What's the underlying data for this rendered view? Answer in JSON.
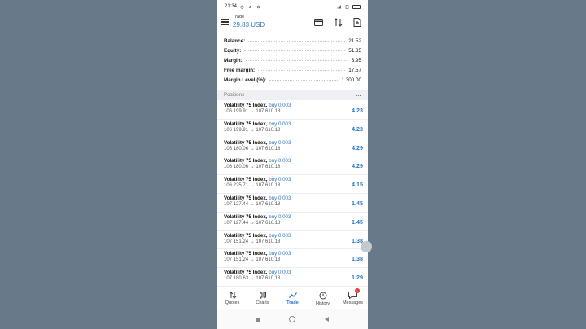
{
  "status": {
    "time": "21:34"
  },
  "header": {
    "title": "Trade",
    "balance": "29.83 USD"
  },
  "balances": [
    {
      "label": "Balance:",
      "value": "21.52"
    },
    {
      "label": "Equity:",
      "value": "51.35"
    },
    {
      "label": "Margin:",
      "value": "3.95"
    },
    {
      "label": "Free margin:",
      "value": "17.57"
    },
    {
      "label": "Margin Level (%):",
      "value": "1 300.00"
    }
  ],
  "positions_header": {
    "title": "Positions",
    "more": "..."
  },
  "positions": [
    {
      "symbol": "Volatility 75 Index,",
      "side": "buy 0.003",
      "prices": "106 199.91 → 107 610.18",
      "profit": "4.23"
    },
    {
      "symbol": "Volatility 75 Index,",
      "side": "buy 0.003",
      "prices": "106 199.91 → 107 610.18",
      "profit": "4.23"
    },
    {
      "symbol": "Volatility 75 Index,",
      "side": "buy 0.003",
      "prices": "106 180.06 → 107 610.18",
      "profit": "4.29"
    },
    {
      "symbol": "Volatility 75 Index,",
      "side": "buy 0.003",
      "prices": "106 180.06 → 107 610.18",
      "profit": "4.29"
    },
    {
      "symbol": "Volatility 75 Index,",
      "side": "buy 0.003",
      "prices": "106 225.71 → 107 610.18",
      "profit": "4.15"
    },
    {
      "symbol": "Volatility 75 Index,",
      "side": "buy 0.003",
      "prices": "107 127.44 → 107 610.18",
      "profit": "1.45"
    },
    {
      "symbol": "Volatility 75 Index,",
      "side": "buy 0.003",
      "prices": "107 127.44 → 107 610.18",
      "profit": "1.45"
    },
    {
      "symbol": "Volatility 75 Index,",
      "side": "buy 0.003",
      "prices": "107 151.24 → 107 610.18",
      "profit": "1.38"
    },
    {
      "symbol": "Volatility 75 Index,",
      "side": "buy 0.003",
      "prices": "107 151.24 → 107 610.18",
      "profit": "1.38"
    },
    {
      "symbol": "Volatility 75 Index,",
      "side": "buy 0.003",
      "prices": "107 180.63 → 107 610.18",
      "profit": "1.29"
    }
  ],
  "nav": {
    "quotes": "Quotes",
    "charts": "Charts",
    "trade": "Trade",
    "history": "History",
    "messages": "Messages",
    "messages_badge": "1"
  },
  "colors": {
    "accent": "#2a78c9",
    "background": "#687a8a"
  }
}
